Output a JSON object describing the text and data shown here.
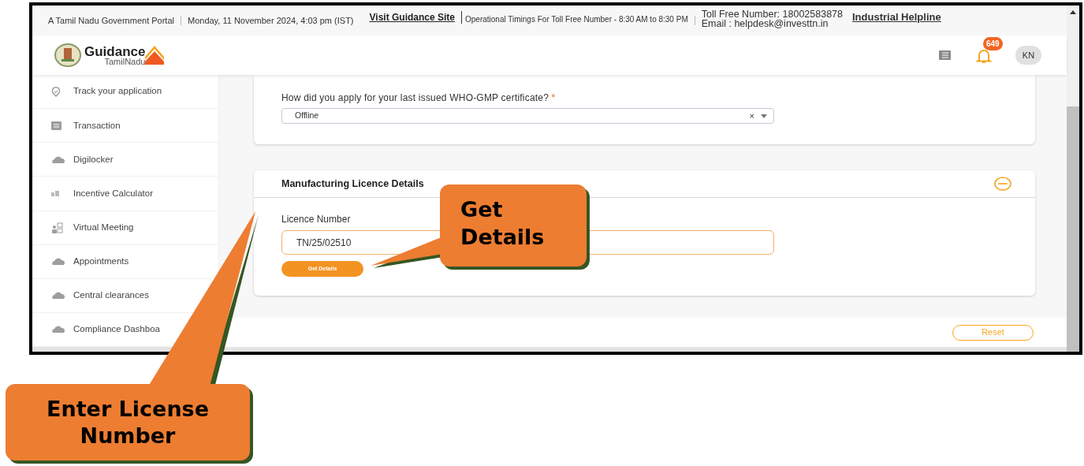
{
  "top_bar": {
    "portal": "A Tamil Nadu Government Portal",
    "datetime": "Monday, 11 November 2024, 4:03 pm (IST)",
    "guidance_link": "Visit Guidance Site",
    "timings": "Operational Timings For Toll Free Number - 8:30 AM to 8:30 PM",
    "toll_free": "Toll Free Number: 18002583878",
    "email": "Email : helpdesk@investtn.in",
    "helpline_link": "Industrial Helpline"
  },
  "header": {
    "logo_title": "Guidance",
    "logo_subtitle": "TamilNadu",
    "notification_count": "649",
    "avatar": "KN"
  },
  "sidebar": {
    "items": [
      {
        "label": "Track your application"
      },
      {
        "label": "Transaction"
      },
      {
        "label": "Digilocker"
      },
      {
        "label": "Incentive Calculator"
      },
      {
        "label": "Virtual Meeting"
      },
      {
        "label": "Appointments"
      },
      {
        "label": "Central clearances"
      },
      {
        "label": "Compliance Dashboa"
      }
    ]
  },
  "question_card": {
    "question": "How did you apply for your last issued WHO-GMP certificate?",
    "required_mark": "*",
    "value": "Offline",
    "clear": "×"
  },
  "licence_card": {
    "title": "Manufacturing Licence Details",
    "expanded": true,
    "field_label": "Licence Number",
    "value": "TN/25/02510",
    "button": "Get Details"
  },
  "footer": {
    "reset": "Reset"
  },
  "callouts": [
    {
      "text": "Get Details"
    },
    {
      "text": "Enter License Number"
    }
  ]
}
